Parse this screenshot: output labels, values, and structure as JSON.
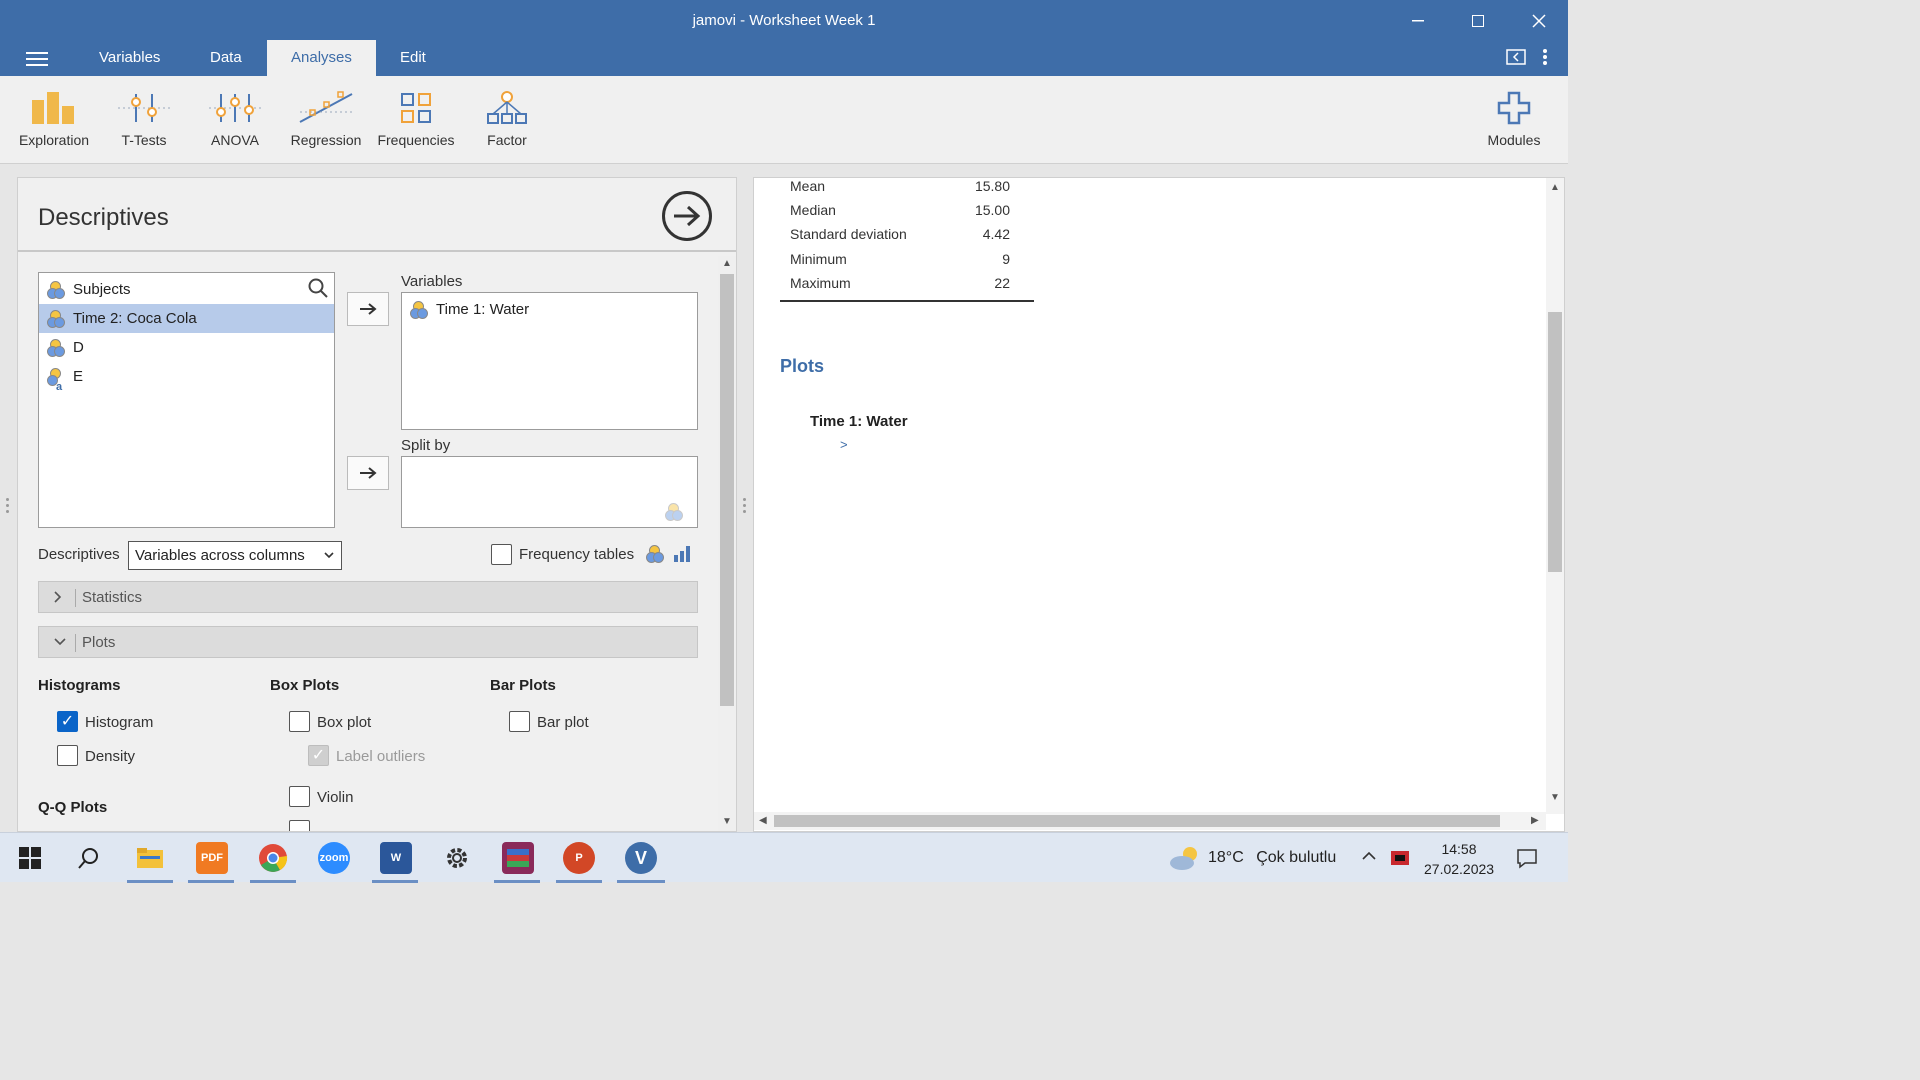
{
  "window": {
    "title": "jamovi - Worksheet Week 1"
  },
  "menu": {
    "tabs": [
      {
        "label": "Variables"
      },
      {
        "label": "Data"
      },
      {
        "label": "Analyses"
      },
      {
        "label": "Edit"
      }
    ],
    "active_tab": "Analyses"
  },
  "ribbon": {
    "buttons": [
      {
        "label": "Exploration"
      },
      {
        "label": "T-Tests"
      },
      {
        "label": "ANOVA"
      },
      {
        "label": "Regression"
      },
      {
        "label": "Frequencies"
      },
      {
        "label": "Factor"
      }
    ],
    "modules_label": "Modules"
  },
  "analysis": {
    "title": "Descriptives",
    "source_variables": [
      {
        "name": "Subjects",
        "selected": false,
        "type": "continuous"
      },
      {
        "name": "Time 2: Coca Cola",
        "selected": true,
        "type": "continuous"
      },
      {
        "name": "D",
        "selected": false,
        "type": "continuous"
      },
      {
        "name": "E",
        "selected": false,
        "type": "nominal-text"
      }
    ],
    "variables_label": "Variables",
    "variables": [
      {
        "name": "Time 1: Water"
      }
    ],
    "split_by_label": "Split by",
    "descriptives_label": "Descriptives",
    "descriptives_value": "Variables across columns",
    "frequency_tables_label": "Frequency tables",
    "frequency_tables_checked": false,
    "statistics_label": "Statistics",
    "plots_label": "Plots",
    "histograms": {
      "title": "Histograms",
      "histogram_label": "Histogram",
      "histogram_checked": true,
      "density_label": "Density",
      "density_checked": false
    },
    "box_plots": {
      "title": "Box Plots",
      "box_plot_label": "Box plot",
      "box_plot_checked": false,
      "label_outliers_label": "Label outliers",
      "label_outliers_checked": true,
      "violin_label": "Violin",
      "violin_checked": false
    },
    "bar_plots": {
      "title": "Bar Plots",
      "bar_plot_label": "Bar plot",
      "bar_plot_checked": false
    },
    "qq_plots_title": "Q-Q Plots"
  },
  "results": {
    "stats": [
      {
        "label": "Mean",
        "value": "15.80"
      },
      {
        "label": "Median",
        "value": "15.00"
      },
      {
        "label": "Standard deviation",
        "value": "4.42"
      },
      {
        "label": "Minimum",
        "value": "9"
      },
      {
        "label": "Maximum",
        "value": "22"
      }
    ],
    "plots_heading": "Plots",
    "plot_title": "Time 1: Water",
    "plot_expander": ">"
  },
  "taskbar": {
    "weather_temp": "18°C",
    "weather_text": "Çok bulutlu",
    "time": "14:58",
    "date": "27.02.2023",
    "zoom_label": "zoom"
  },
  "colors": {
    "brand": "#3e6da8",
    "selection": "#b7cbea",
    "checkbox": "#0a64c8"
  }
}
